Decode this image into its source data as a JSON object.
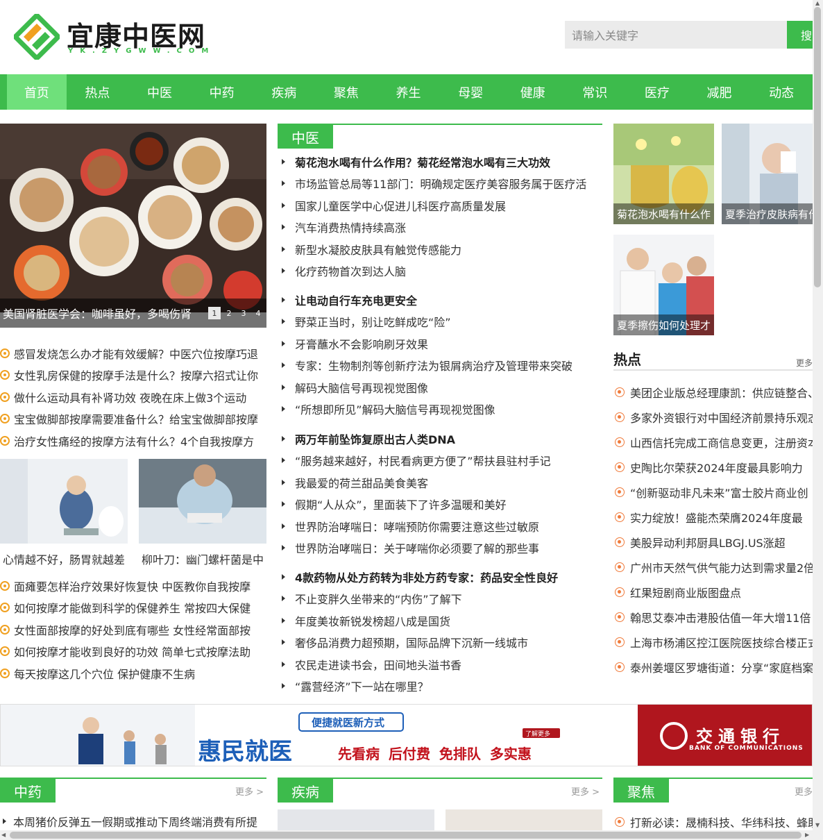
{
  "header": {
    "logo_title": "宜康中医网",
    "logo_sub": "YK.ZYGWW.COM",
    "search_placeholder": "请输入关键字",
    "search_button": "搜"
  },
  "nav": [
    "首页",
    "热点",
    "中医",
    "中药",
    "疾病",
    "聚焦",
    "养生",
    "母婴",
    "健康",
    "常识",
    "医疗",
    "减肥",
    "动态"
  ],
  "slider": {
    "caption": "美国肾脏医学会：咖啡虽好，多喝伤肾",
    "dots": [
      "1",
      "2",
      "3",
      "4"
    ]
  },
  "left_list_1": [
    "感冒发烧怎么办才能有效缓解？中医穴位按摩巧退",
    "女性乳房保健的按摩手法是什么？按摩六招式让你",
    "做什么运动具有补肾功效 夜晚在床上做3个运动",
    "宝宝做脚部按摩需要准备什么？给宝宝做脚部按摩",
    "治疗女性痛经的按摩方法有什么？4个自我按摩方"
  ],
  "left_thumbs": [
    "心情越不好，肠胃就越差",
    "柳叶刀：幽门螺杆菌是中"
  ],
  "left_list_2": [
    "面瘫要怎样治疗效果好恢复快 中医教你自我按摩",
    "如何按摩才能做到科学的保健养生 常按四大保健",
    "女性面部按摩的好处到底有哪些 女性经常面部按",
    "如何按摩才能收到良好的功效 简单七式按摩法助",
    "每天按摩这几个穴位 保护健康不生病"
  ],
  "mid": {
    "tag": "中医",
    "groups": [
      [
        "菊花泡水喝有什么作用？菊花经常泡水喝有三大功效",
        "市场监管总局等11部门：明确规定医疗美容服务属于医疗活",
        "国家儿童医学中心促进儿科医疗高质量发展",
        "汽车消费热情持续高涨",
        "新型水凝胶皮肤具有触觉传感能力",
        "化疗药物首次到达人脑"
      ],
      [
        "让电动自行车充电更安全",
        "野菜正当时，别让吃鲜成吃“险”",
        "牙膏蘸水不会影响刷牙效果",
        "专家：生物制剂等创新疗法为银屑病治疗及管理带来突破",
        "解码大脑信号再现视觉图像",
        "“所想即所见”解码大脑信号再现视觉图像"
      ],
      [
        "两万年前坠饰复原出古人类DNA",
        "“服务越来越好，村民看病更方便了”帮扶县驻村手记",
        "我最爱的荷兰甜品美食美客",
        "假期“人从众”，里面装下了许多温暖和美好",
        "世界防治哮喘日：哮喘预防你需要注意这些过敏原",
        "世界防治哮喘日：关于哮喘你必须要了解的那些事"
      ],
      [
        "4款药物从处方药转为非处方药专家：药品安全性良好",
        "不止变胖久坐带来的“内伤”了解下",
        "年度美妆新锐发榜超八成是国货",
        "奢侈品消费力超预期，国际品牌下沉新一线城市",
        "农民走进读书会，田间地头溢书香",
        "“露营经济”下一站在哪里？"
      ]
    ]
  },
  "right_thumbs": [
    "菊花泡水喝有什么作",
    "夏季治疗皮肤病有什",
    "夏季擦伤如何处理才"
  ],
  "hot": {
    "title": "热点",
    "more": "更多",
    "items": [
      "美团企业版总经理康凯：供应链整合、",
      "多家外资银行对中国经济前景持乐观态",
      "山西信托完成工商信息变更，注册资本",
      "史陶比尔荣获2024年度最具影响力",
      "“创新驱动非凡未来”富士胶片商业创",
      "实力绽放！盛能杰荣膺2024年度最",
      "美股异动利邦厨具LBGJ.US涨超",
      "广州市天然气供气能力达到需求量2倍",
      "红果短剧商业版图盘点",
      "翰思艾泰冲击港股估值一年大增11倍",
      "上海市杨浦区控江医院医技综合楼正式",
      "泰州姜堰区罗塘街道：分享“家庭档案"
    ]
  },
  "banner": {
    "slogan_top": "便捷就医新方式",
    "slogan_main": "惠民就医",
    "slogan_items": "先看病 后付费 免排队 多实惠",
    "learn_more": "了解更多",
    "bank_cn": "交通银行",
    "bank_en": "BANK OF COMMUNICATIONS"
  },
  "bottom": {
    "zy_tag": "中药",
    "zy_more": "更多 >",
    "zy_item": "本周猪价反弹五一假期或推动下周终端消费有所提",
    "jb_tag": "疾病",
    "jb_more": "更多 >",
    "jj_tag": "聚焦",
    "jj_more": "更多",
    "jj_item": "打新必读：晟楠科技、华纬科技、蜂助"
  }
}
